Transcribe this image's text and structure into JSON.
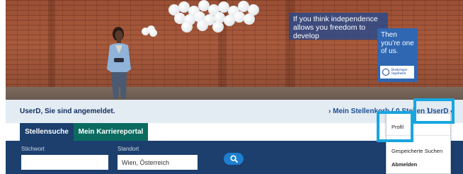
{
  "hero": {
    "quote": "If you think independence allows you freedom to develop",
    "cta": "Then you’re one of us.",
    "logo": "Boehringer Ingelheim"
  },
  "userbar": {
    "logged_in": "UserD, Sie sind angemeldet.",
    "stellenkorb": "› Mein Stellenkorb ( 0 Stellen )",
    "user_name": "UserD"
  },
  "tabs": [
    {
      "label": "Stellensuche",
      "active": true
    },
    {
      "label": "Mein Karriereportal",
      "active": false
    }
  ],
  "search": {
    "keyword_label": "Stichwort",
    "keyword_value": "",
    "location_label": "Standort",
    "location_value": "Wien, Österreich"
  },
  "dropdown": {
    "items": [
      {
        "label": "Profil"
      },
      {
        "label": "Gespeicherte Suchen"
      },
      {
        "label": "Abmelden"
      }
    ]
  },
  "colors": {
    "navy": "#1c3f6e",
    "teal": "#0b6b60",
    "highlight": "#18a6e0",
    "button": "#1e7fd0"
  }
}
